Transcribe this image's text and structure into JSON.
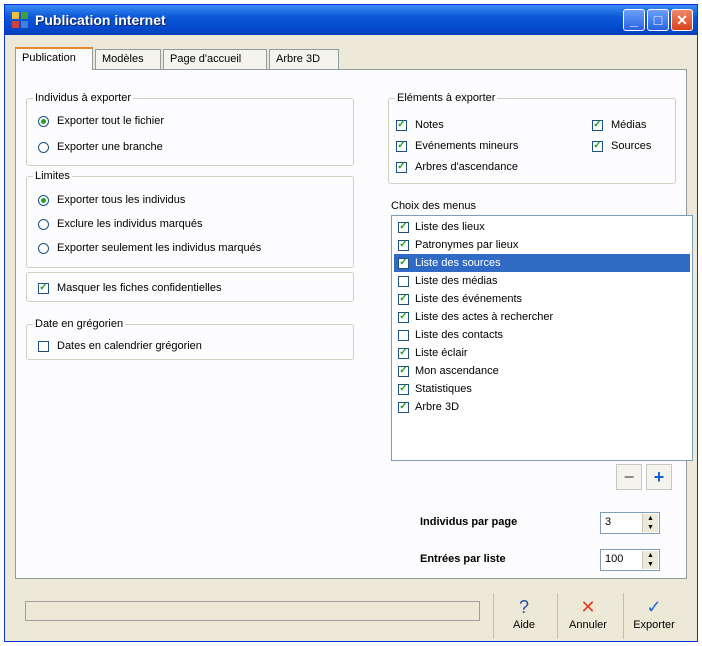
{
  "window": {
    "title": "Publication internet",
    "minimize": "_",
    "maximize": "□",
    "close": "✕"
  },
  "tabs": [
    "Publication",
    "Modèles",
    "Page d'accueil",
    "Arbre 3D"
  ],
  "individus": {
    "legend": "Individus à exporter",
    "options": [
      {
        "label": "Exporter tout le fichier",
        "selected": true
      },
      {
        "label": "Exporter une branche",
        "selected": false
      }
    ]
  },
  "limites": {
    "legend": "Limites",
    "options": [
      {
        "label": "Exporter tous les individus",
        "selected": true
      },
      {
        "label": "Exclure les individus marqués",
        "selected": false
      },
      {
        "label": "Exporter seulement les individus marqués",
        "selected": false
      }
    ]
  },
  "masquer": {
    "label": "Masquer les fiches confidentielles",
    "checked": true
  },
  "date": {
    "legend": "Date en grégorien",
    "checkbox": {
      "label": "Dates en calendrier grégorien",
      "checked": false
    }
  },
  "elements": {
    "legend": "Eléments à exporter",
    "items": [
      {
        "label": "Notes",
        "checked": true
      },
      {
        "label": "Médias",
        "checked": true
      },
      {
        "label": "Evénements mineurs",
        "checked": true
      },
      {
        "label": "Sources",
        "checked": true
      },
      {
        "label": "Arbres d'ascendance",
        "checked": true
      }
    ]
  },
  "menus": {
    "label": "Choix des menus",
    "items": [
      {
        "label": "Liste des lieux",
        "checked": true,
        "selected": false
      },
      {
        "label": "Patronymes par lieux",
        "checked": true,
        "selected": false
      },
      {
        "label": "Liste des sources",
        "checked": true,
        "selected": true
      },
      {
        "label": "Liste des médias",
        "checked": false,
        "selected": false
      },
      {
        "label": "Liste des événements",
        "checked": true,
        "selected": false
      },
      {
        "label": "Liste des actes à rechercher",
        "checked": true,
        "selected": false
      },
      {
        "label": "Liste des contacts",
        "checked": false,
        "selected": false
      },
      {
        "label": "Liste éclair",
        "checked": true,
        "selected": false
      },
      {
        "label": "Mon ascendance",
        "checked": true,
        "selected": false
      },
      {
        "label": "Statistiques",
        "checked": true,
        "selected": false
      },
      {
        "label": "Arbre 3D",
        "checked": true,
        "selected": false
      }
    ],
    "remove_label": "−",
    "add_label": "+"
  },
  "spinners": {
    "individus_par_page": {
      "label": "Individus par page",
      "value": "3"
    },
    "entrees_par_liste": {
      "label": "Entrées par liste",
      "value": "100"
    }
  },
  "buttons": {
    "aide": "Aide",
    "annuler": "Annuler",
    "exporter": "Exporter"
  }
}
